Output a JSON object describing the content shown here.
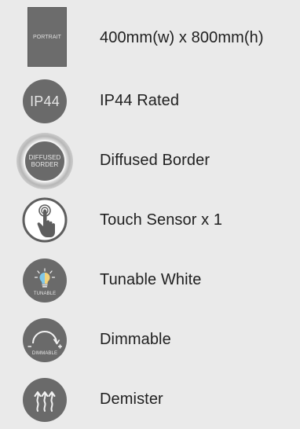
{
  "features": [
    {
      "icon": "portrait-icon",
      "icon_text": "PORTRAIT",
      "label": "400mm(w) x 800mm(h)"
    },
    {
      "icon": "ip44-icon",
      "icon_text": "IP44",
      "label": "IP44 Rated"
    },
    {
      "icon": "diffused-border-icon",
      "icon_text_line1": "DIFFUSED",
      "icon_text_line2": "BORDER",
      "label": "Diffused Border"
    },
    {
      "icon": "touch-sensor-icon",
      "label": "Touch Sensor x 1"
    },
    {
      "icon": "tunable-white-icon",
      "icon_text": "TUNABLE",
      "label": "Tunable White"
    },
    {
      "icon": "dimmable-icon",
      "icon_text": "DIMMABLE",
      "label": "Dimmable"
    },
    {
      "icon": "demister-icon",
      "label": "Demister"
    }
  ],
  "colors": {
    "background": "#eaeaea",
    "icon_fill": "#6a6a6a",
    "icon_text": "#e8e8e8",
    "label_text": "#1f1f1f"
  }
}
